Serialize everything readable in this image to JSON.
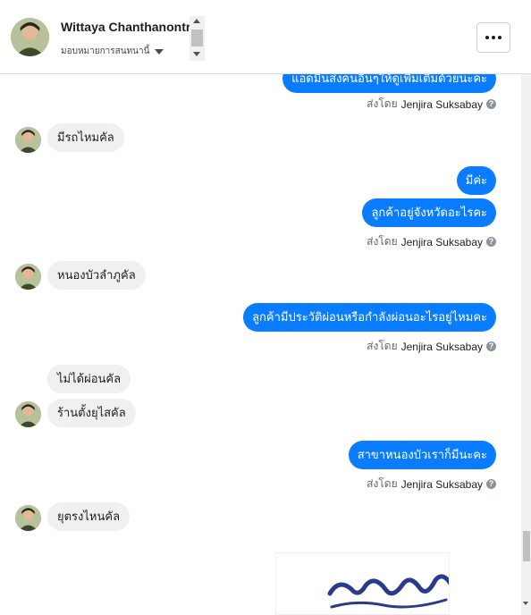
{
  "header": {
    "contact_name": "Wittaya Chanthanontri",
    "assign_label": "มอบหมายการสนทนานี้",
    "avatar_icon": "contact-avatar",
    "more_icon": "more-options-icon"
  },
  "colors": {
    "outgoing_bubble": "#0a7cff",
    "incoming_bubble": "#f0f0f0",
    "meta_text": "#606770"
  },
  "thread": {
    "sent_by_prefix": "ส่งโดย",
    "messages": [
      {
        "direction": "out",
        "text": "แอดมินส่งคนอื่นๆให้ดูเพิ่มเติมด้วยนะคะ",
        "sent_by": "Jenjira Suksabay"
      },
      {
        "direction": "in",
        "text": "มีรถไหมคัล"
      },
      {
        "direction": "out",
        "text": "มีค่ะ"
      },
      {
        "direction": "out",
        "text": "ลูกค้าอยู่จังหวัดอะไรคะ",
        "sent_by": "Jenjira Suksabay"
      },
      {
        "direction": "in",
        "text": "หนองบัวลำภูคัล"
      },
      {
        "direction": "out",
        "text": "ลูกค้ามีประวัติผ่อนหรือกำลังผ่อนอะไรอยู่ไหมคะ",
        "sent_by": "Jenjira Suksabay"
      },
      {
        "direction": "in",
        "text": "ไม่ได้ผ่อนคัล"
      },
      {
        "direction": "in",
        "text": "ร้านตั้งยุไสคัล"
      },
      {
        "direction": "out",
        "text": "สาขาหนองบัวเราก็มีนะคะ",
        "sent_by": "Jenjira Suksabay"
      },
      {
        "direction": "in",
        "text": "ยุตรงไหนคัล"
      }
    ]
  }
}
